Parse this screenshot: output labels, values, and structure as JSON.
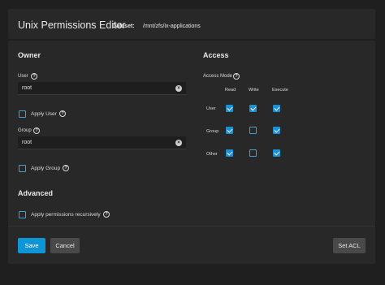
{
  "header": {
    "title": "Unix Permissions Editor",
    "dataset_label": "Dataset:",
    "dataset_value": "/mnt/zfs/ix-applications"
  },
  "owner": {
    "section_title": "Owner",
    "user_label": "User",
    "user_value": "root",
    "apply_user_label": "Apply User",
    "apply_user_checked": false,
    "group_label": "Group",
    "group_value": "root",
    "apply_group_label": "Apply Group",
    "apply_group_checked": false
  },
  "access": {
    "section_title": "Access",
    "mode_label": "Access Mode",
    "columns": [
      "Read",
      "Write",
      "Execute"
    ],
    "rows": [
      {
        "label": "User",
        "read": true,
        "write": true,
        "execute": true
      },
      {
        "label": "Group",
        "read": true,
        "write": false,
        "execute": true
      },
      {
        "label": "Other",
        "read": true,
        "write": false,
        "execute": true
      }
    ]
  },
  "advanced": {
    "section_title": "Advanced",
    "recursive_label": "Apply permissions recursively",
    "recursive_checked": false
  },
  "actions": {
    "save_label": "Save",
    "cancel_label": "Cancel",
    "set_acl_label": "Set ACL"
  },
  "colors": {
    "accent": "#0d95d6",
    "panel": "#282828",
    "background": "#1f1f1f"
  },
  "icons": {
    "help": "help-circle-icon",
    "clear": "clear-circle-icon",
    "check": "checkmark-icon"
  }
}
